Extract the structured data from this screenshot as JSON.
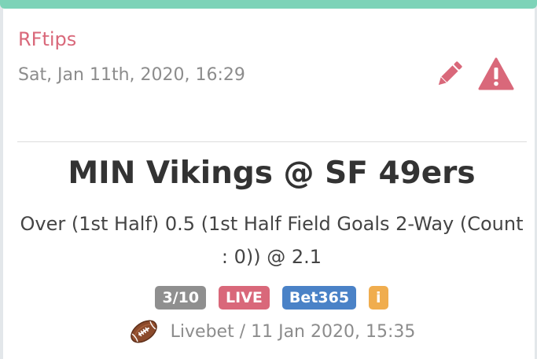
{
  "post": {
    "author": "RFtips",
    "date": "Sat, Jan 11th, 2020, 16:29"
  },
  "actions": {
    "edit_icon": "pencil-icon",
    "report_icon": "warning-icon"
  },
  "tip": {
    "match": "MIN Vikings @ SF 49ers",
    "description": "Over (1st Half) 0.5 (1st Half Field Goals 2-Way (Count : 0)) @ 2.1",
    "badges": [
      {
        "label": "3/10",
        "color": "#8f8f8f"
      },
      {
        "label": "LIVE",
        "color": "#d9687a"
      },
      {
        "label": "Bet365",
        "color": "#4a82c7"
      },
      {
        "label": "i",
        "color": "#f0ad4e"
      }
    ],
    "sport_icon": "american-football-icon",
    "footer": "Livebet / 11 Jan 2020, 15:35"
  },
  "colors": {
    "accent": "#d9687a",
    "top_bar": "#7dd3b8",
    "muted_text": "#8c8c8c"
  }
}
